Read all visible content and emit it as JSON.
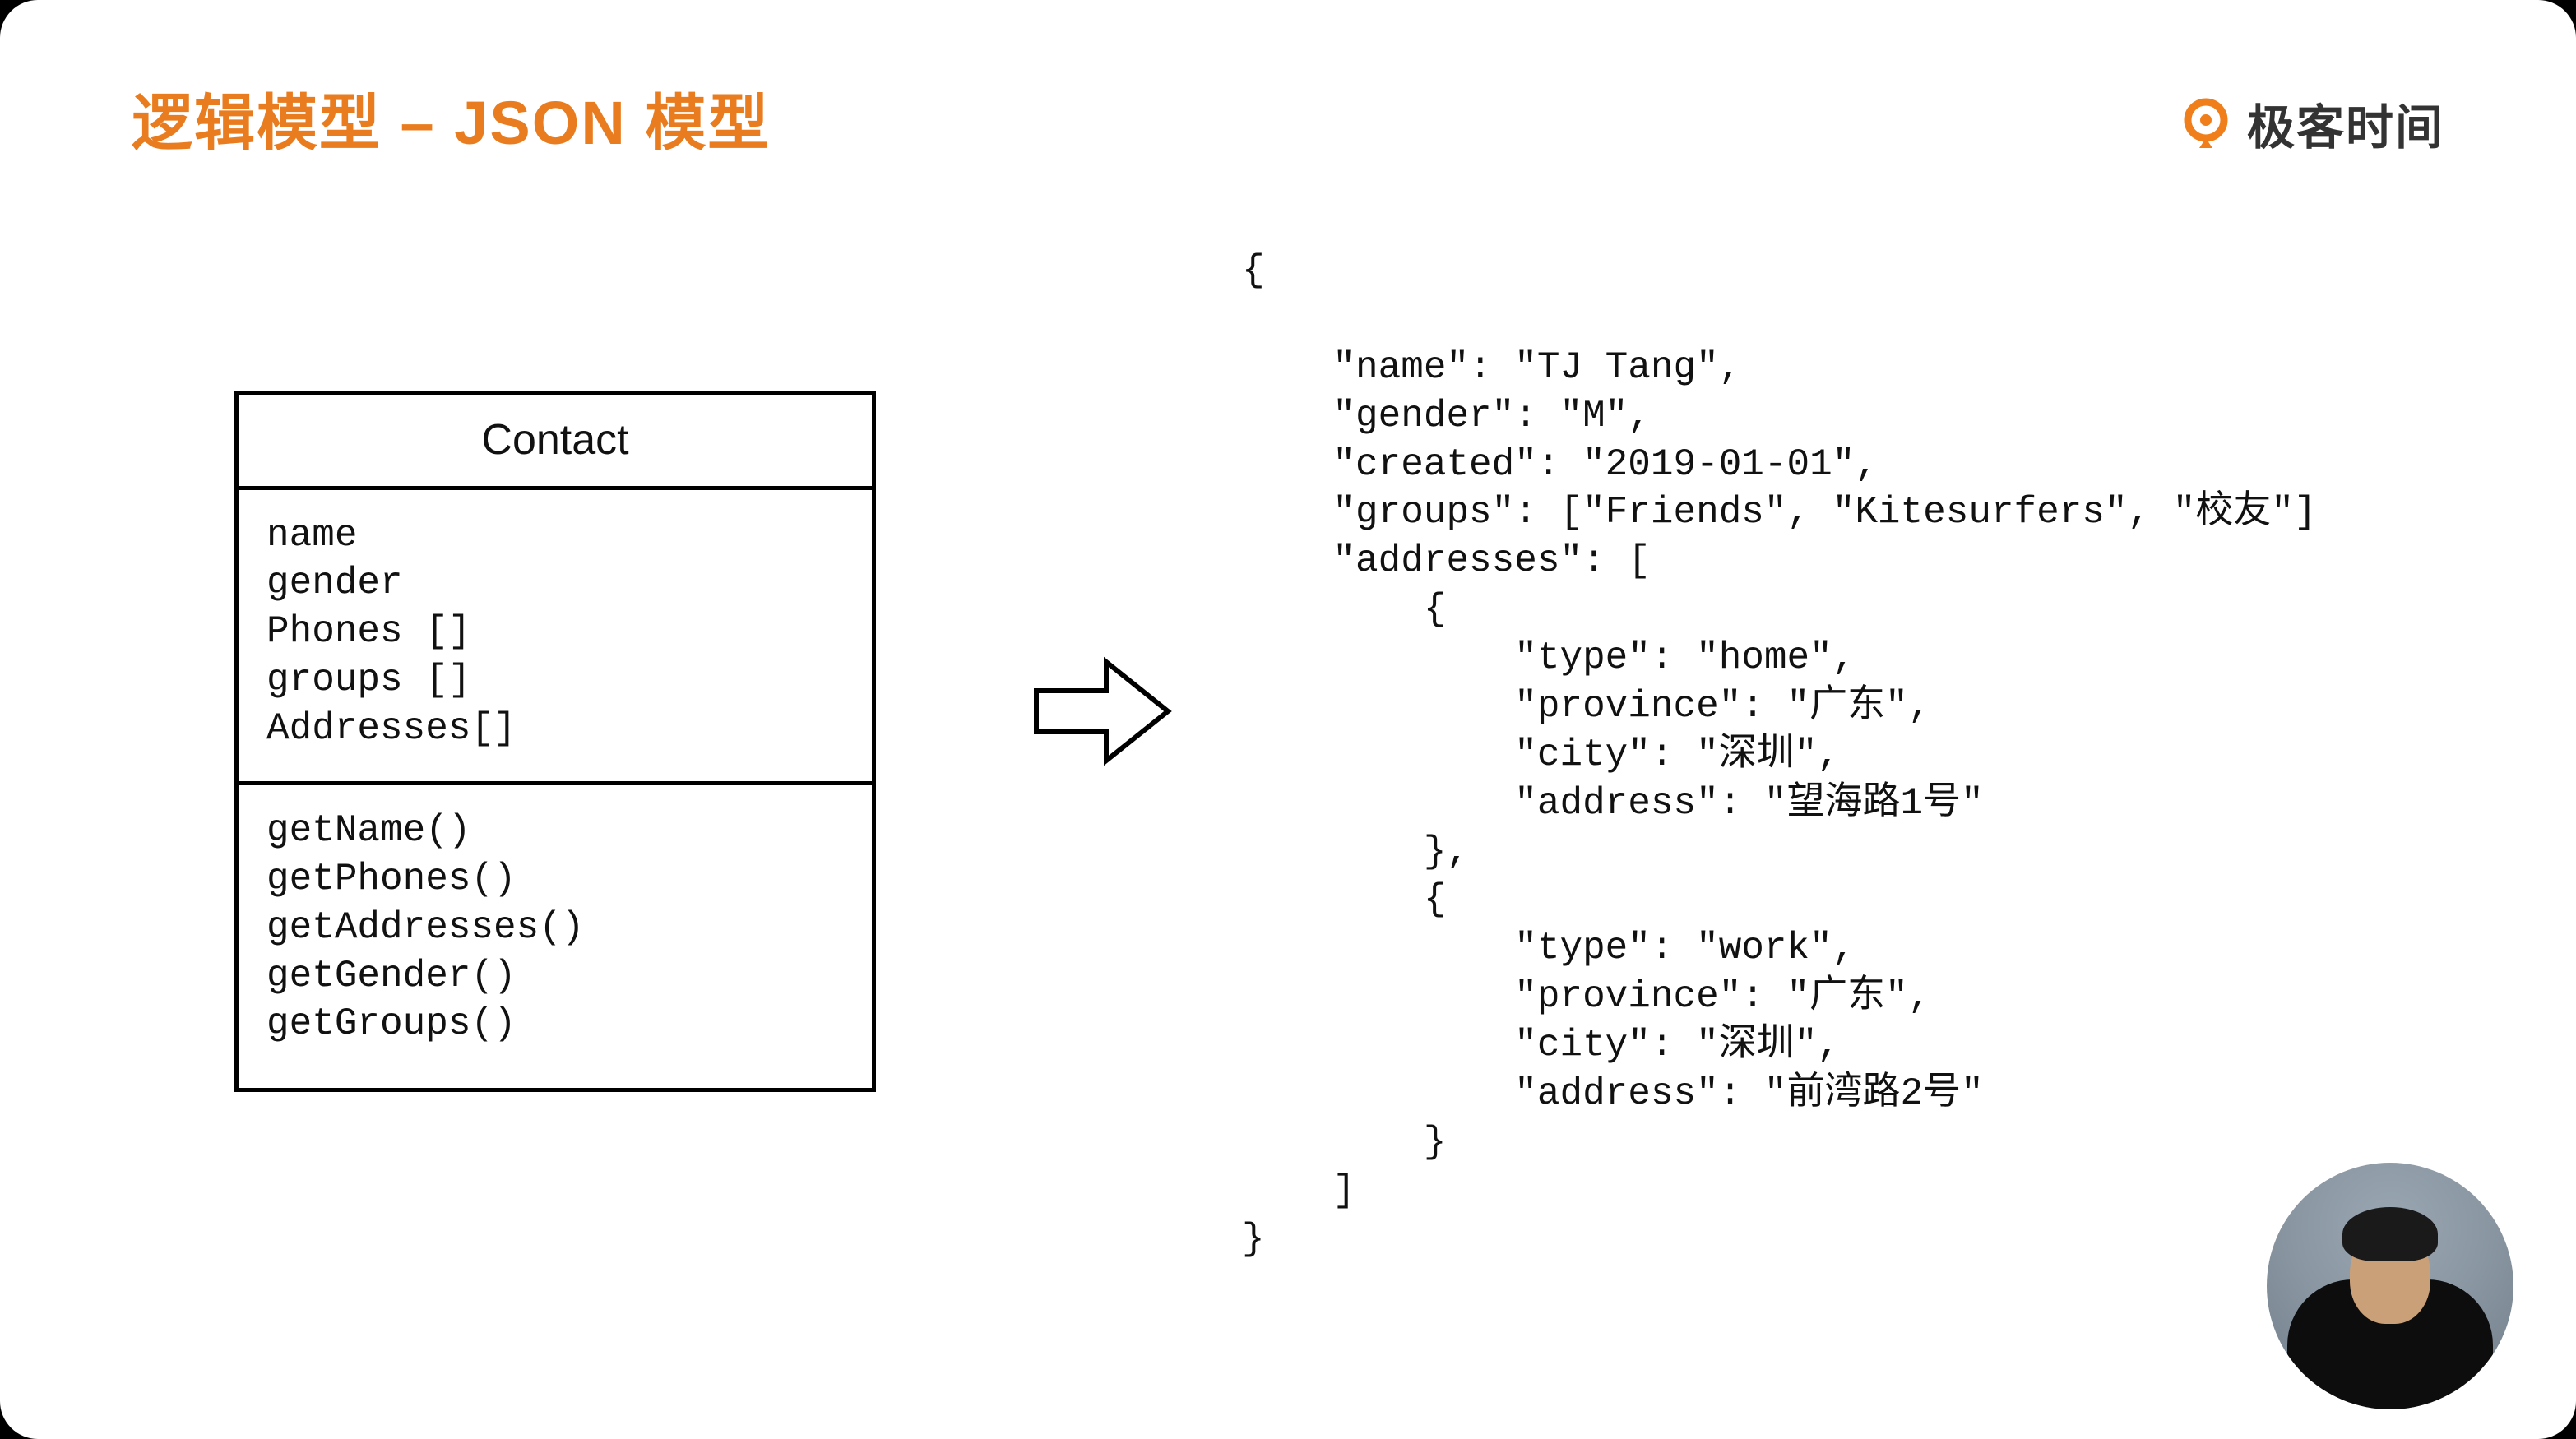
{
  "brand": {
    "name": "极客时间"
  },
  "slide": {
    "title": "逻辑模型 – JSON 模型"
  },
  "uml": {
    "class_name": "Contact",
    "attributes": [
      "name",
      "gender",
      "Phones []",
      "groups []",
      "Addresses[]"
    ],
    "methods": [
      "getName()",
      "getPhones()",
      "getAddresses()",
      "getGender()",
      "getGroups()"
    ]
  },
  "json_example": "{\n\n    \"name\": \"TJ Tang\",\n    \"gender\": \"M\",\n    \"created\": \"2019-01-01\",\n    \"groups\": [\"Friends\", \"Kitesurfers\", \"校友\"]\n    \"addresses\": [\n        {\n            \"type\": \"home\",\n            \"province\": \"广东\",\n            \"city\": \"深圳\",\n            \"address\": \"望海路1号\"\n        },\n        {\n            \"type\": \"work\",\n            \"province\": \"广东\",\n            \"city\": \"深圳\",\n            \"address\": \"前湾路2号\"\n        }\n    ]\n}"
}
